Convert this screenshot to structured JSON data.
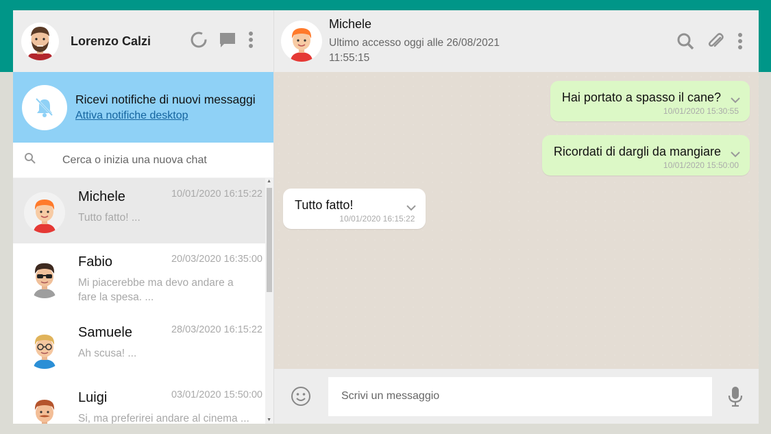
{
  "me": {
    "name": "Lorenzo Calzi"
  },
  "left_header": {
    "icons": [
      "status-icon",
      "chat-icon",
      "menu-icon"
    ]
  },
  "notification": {
    "title": "Ricevi notifiche di nuovi messaggi",
    "link": "Attiva notifiche desktop"
  },
  "search": {
    "placeholder": "Cerca o inizia una nuova chat"
  },
  "chats": [
    {
      "name": "Michele",
      "time": "10/01/2020 16:15:22",
      "preview": "Tutto fatto! ...",
      "active": true
    },
    {
      "name": "Fabio",
      "time": "20/03/2020 16:35:00",
      "preview": "Mi piacerebbe ma devo andare a fare la spesa. ..."
    },
    {
      "name": "Samuele",
      "time": "28/03/2020 16:15:22",
      "preview": "Ah scusa! ..."
    },
    {
      "name": "Luigi",
      "time": "03/01/2020 15:50:00",
      "preview": "Si, ma preferirei andare al cinema ..."
    }
  ],
  "contact": {
    "name": "Michele",
    "status": "Ultimo accesso oggi alle  26/08/2021 11:55:15"
  },
  "messages": [
    {
      "type": "sent",
      "text": "Hai portato a spasso il cane?",
      "time": "10/01/2020 15:30:55"
    },
    {
      "type": "sent",
      "text": "Ricordati di dargli da mangiare",
      "time": "10/01/2020 15:50:00"
    },
    {
      "type": "received",
      "text": "Tutto fatto!",
      "time": "10/01/2020 16:15:22"
    }
  ],
  "composer": {
    "placeholder": "Scrivi un messaggio"
  },
  "colors": {
    "accent": "#009688",
    "sent_bubble": "#dcf8c6",
    "notification_bg": "#8fd1f6"
  }
}
